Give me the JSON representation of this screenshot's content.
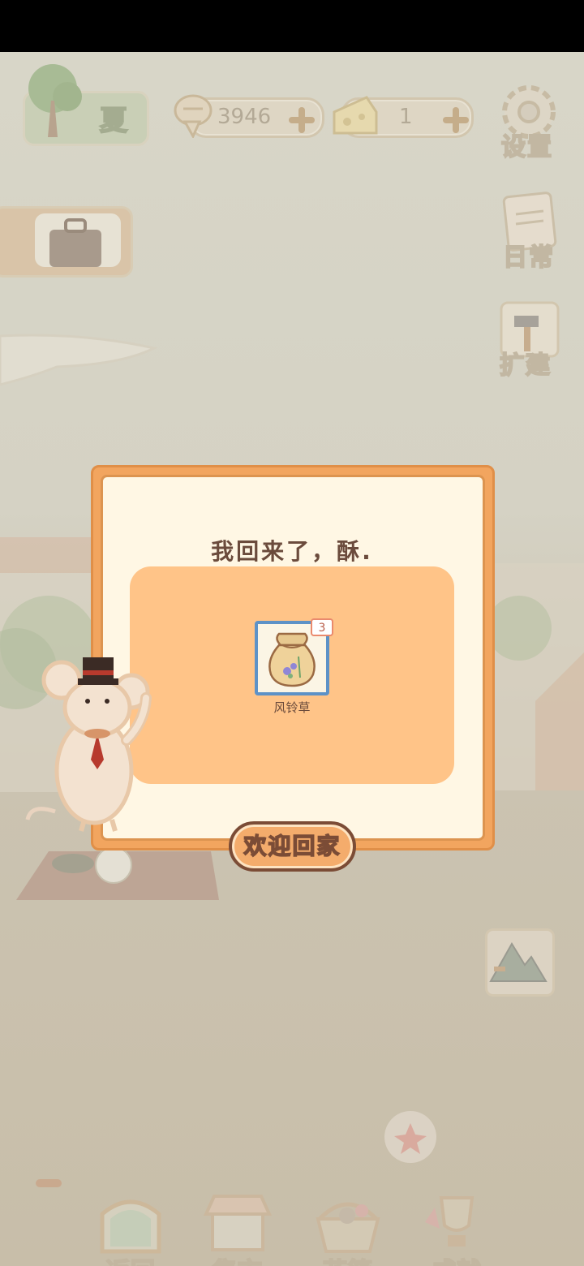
{
  "hud": {
    "season_label": "夏",
    "fish_count": "3946",
    "cheese_count": "1"
  },
  "side_menu": {
    "settings_label": "设置",
    "daily_label": "日常",
    "expand_label": "扩建"
  },
  "dialog": {
    "title": "我回来了，酥.",
    "reward": {
      "name": "风铃草",
      "quantity": "3"
    },
    "welcome_button": "欢迎回家"
  },
  "bottom_nav": {
    "back_label": "返回",
    "market_label": "集市",
    "basket_label": "花篮",
    "achievement_label": "成就"
  },
  "colors": {
    "dialog_border": "#f2a55f",
    "dialog_bg": "#fff7e4",
    "reward_panel": "#ffc488",
    "item_border": "#5d92c7",
    "button_bg": "#f4ac6c",
    "button_outline": "#7b4c36"
  }
}
